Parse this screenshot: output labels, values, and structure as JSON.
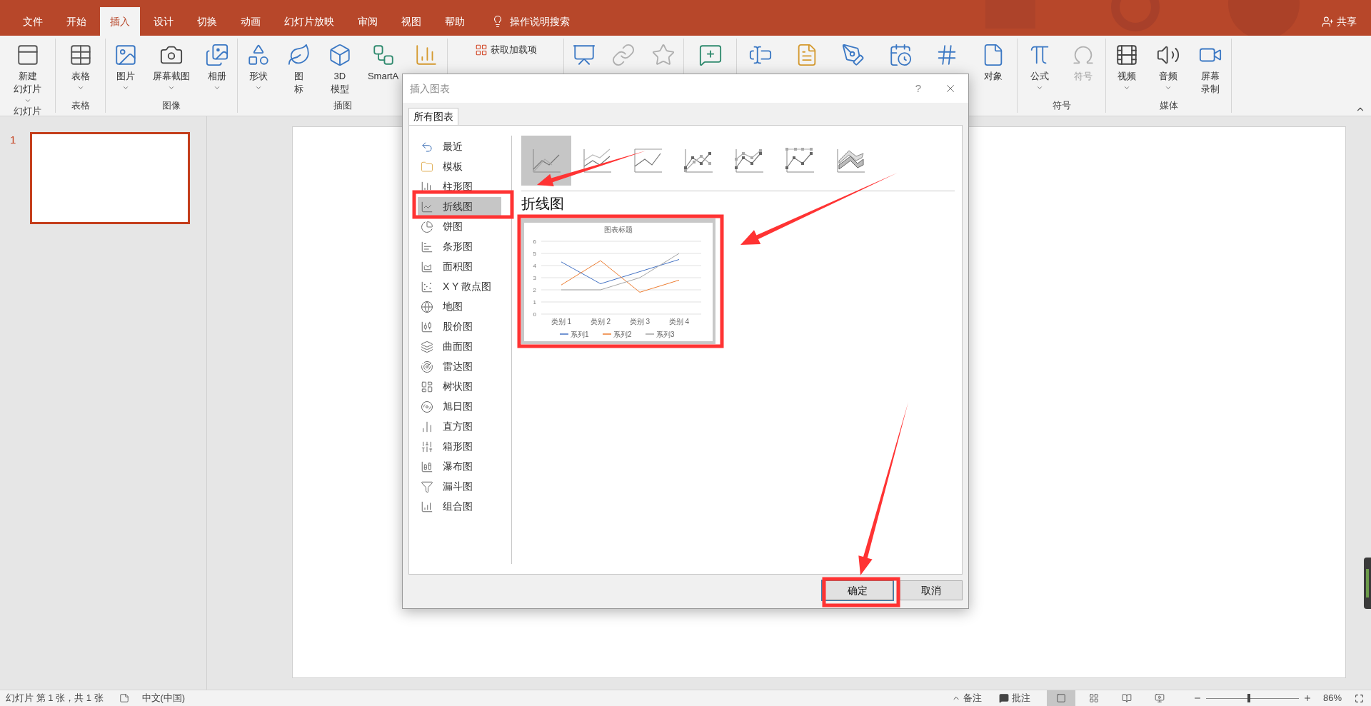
{
  "ribbon_tabs": [
    {
      "label": "文件",
      "selected": false
    },
    {
      "label": "开始",
      "selected": false
    },
    {
      "label": "插入",
      "selected": true
    },
    {
      "label": "设计",
      "selected": false
    },
    {
      "label": "切换",
      "selected": false
    },
    {
      "label": "动画",
      "selected": false
    },
    {
      "label": "幻灯片放映",
      "selected": false
    },
    {
      "label": "审阅",
      "selected": false
    },
    {
      "label": "视图",
      "selected": false
    },
    {
      "label": "帮助",
      "selected": false
    }
  ],
  "tell_me": "操作说明搜索",
  "share": "共享",
  "ribbon_groups": [
    {
      "label": "幻灯片",
      "items": [
        {
          "kind": "large",
          "lines": [
            "新建",
            "幻灯片"
          ],
          "dropdown": true,
          "disabled": false
        }
      ]
    },
    {
      "label": "表格",
      "items": [
        {
          "kind": "large",
          "lines": [
            "表格"
          ],
          "dropdown": true,
          "disabled": false
        }
      ]
    },
    {
      "label": "图像",
      "items": [
        {
          "kind": "large",
          "lines": [
            "图片"
          ],
          "dropdown": true,
          "disabled": false
        },
        {
          "kind": "large",
          "lines": [
            "屏幕截图"
          ],
          "dropdown": true,
          "disabled": false
        },
        {
          "kind": "large",
          "lines": [
            "相册"
          ],
          "dropdown": true,
          "disabled": false
        }
      ]
    },
    {
      "label": "插图",
      "items": [
        {
          "kind": "large",
          "lines": [
            "形状"
          ],
          "dropdown": true,
          "disabled": false
        },
        {
          "kind": "large",
          "lines": [
            "图",
            "标"
          ],
          "dropdown": false,
          "disabled": false
        },
        {
          "kind": "large",
          "lines": [
            "3D",
            "模型"
          ],
          "dropdown": false,
          "disabled": false
        },
        {
          "kind": "large",
          "lines": [
            "SmartA"
          ],
          "dropdown": false,
          "disabled": false
        },
        {
          "kind": "large",
          "dropdown": false,
          "disabled": false
        }
      ]
    },
    {
      "items": [
        {
          "kind": "small",
          "lines": [
            "获取加载项"
          ],
          "dropdown": false,
          "disabled": false
        }
      ]
    },
    {
      "items": [
        {
          "kind": "large",
          "dropdown": false,
          "disabled": false
        },
        {
          "kind": "large",
          "dropdown": false,
          "disabled": true
        },
        {
          "kind": "large",
          "dropdown": false,
          "disabled": true
        }
      ]
    },
    {
      "items": [
        {
          "kind": "large",
          "dropdown": false,
          "disabled": false
        }
      ]
    },
    {
      "items": [
        {
          "kind": "large",
          "dropdown": false,
          "disabled": false
        },
        {
          "kind": "large",
          "dropdown": false,
          "disabled": false
        },
        {
          "kind": "large",
          "dropdown": false,
          "disabled": false
        },
        {
          "kind": "large",
          "dropdown": false,
          "disabled": false
        },
        {
          "kind": "large",
          "dropdown": false,
          "disabled": false
        },
        {
          "kind": "large",
          "lines": [
            "对象"
          ],
          "dropdown": false,
          "disabled": false
        }
      ]
    },
    {
      "label": "符号",
      "items": [
        {
          "kind": "large",
          "lines": [
            "公式"
          ],
          "dropdown": true,
          "disabled": false
        },
        {
          "kind": "large",
          "lines": [
            "符号"
          ],
          "dropdown": false,
          "disabled": true
        }
      ]
    },
    {
      "label": "媒体",
      "items": [
        {
          "kind": "large",
          "lines": [
            "视频"
          ],
          "dropdown": true,
          "disabled": false
        },
        {
          "kind": "large",
          "lines": [
            "音频"
          ],
          "dropdown": true,
          "disabled": false
        },
        {
          "kind": "large",
          "lines": [
            "屏幕",
            "录制"
          ],
          "dropdown": false,
          "disabled": false
        }
      ]
    }
  ],
  "slides": [
    {
      "number": "1",
      "selected": true
    }
  ],
  "dialog": {
    "title": "插入图表",
    "help": "?",
    "tabs": [
      {
        "label": "所有图表",
        "selected": true
      }
    ],
    "categories": [
      {
        "label": "最近",
        "selected": false
      },
      {
        "label": "模板",
        "selected": false
      },
      {
        "label": "柱形图",
        "selected": false
      },
      {
        "label": "折线图",
        "selected": true
      },
      {
        "label": "饼图",
        "selected": false
      },
      {
        "label": "条形图",
        "selected": false
      },
      {
        "label": "面积图",
        "selected": false
      },
      {
        "label": "X Y 散点图",
        "selected": false
      },
      {
        "label": "地图",
        "selected": false
      },
      {
        "label": "股价图",
        "selected": false
      },
      {
        "label": "曲面图",
        "selected": false
      },
      {
        "label": "雷达图",
        "selected": false
      },
      {
        "label": "树状图",
        "selected": false
      },
      {
        "label": "旭日图",
        "selected": false
      },
      {
        "label": "直方图",
        "selected": false
      },
      {
        "label": "箱形图",
        "selected": false
      },
      {
        "label": "瀑布图",
        "selected": false
      },
      {
        "label": "漏斗图",
        "selected": false
      },
      {
        "label": "组合图",
        "selected": false
      }
    ],
    "subtypes": [
      {
        "selected": true
      },
      {
        "selected": false
      },
      {
        "selected": false
      },
      {
        "selected": false
      },
      {
        "selected": false
      },
      {
        "selected": false
      },
      {
        "selected": false
      }
    ],
    "heading": "折线图",
    "preview": {
      "chart_data": {
        "type": "line",
        "title": "图表标题",
        "categories": [
          "类别 1",
          "类别 2",
          "类别 3",
          "类别 4"
        ],
        "series": [
          {
            "name": "系列1",
            "color": "#4472c4",
            "values": [
              4.3,
              2.5,
              3.5,
              4.5
            ]
          },
          {
            "name": "系列2",
            "color": "#ed7d31",
            "values": [
              2.4,
              4.4,
              1.8,
              2.8
            ]
          },
          {
            "name": "系列3",
            "color": "#a5a5a5",
            "values": [
              2,
              2,
              3,
              5
            ]
          }
        ],
        "ylim": [
          0,
          6
        ],
        "yticks": [
          0,
          1,
          2,
          3,
          4,
          5,
          6
        ],
        "grid": true,
        "legend": "bottom"
      }
    },
    "buttons": [
      {
        "label": "确定",
        "default": true
      },
      {
        "label": "取消",
        "default": false
      }
    ]
  },
  "status_bar": {
    "slide_info": "幻灯片 第 1 张，共 1 张",
    "language": "中文(中国)",
    "notes": "备注",
    "comments": "批注",
    "views": [
      {
        "selected": true
      },
      {
        "selected": false
      },
      {
        "selected": false
      },
      {
        "selected": false
      }
    ],
    "zoom": {
      "level": 0.46,
      "label": "86%"
    }
  }
}
